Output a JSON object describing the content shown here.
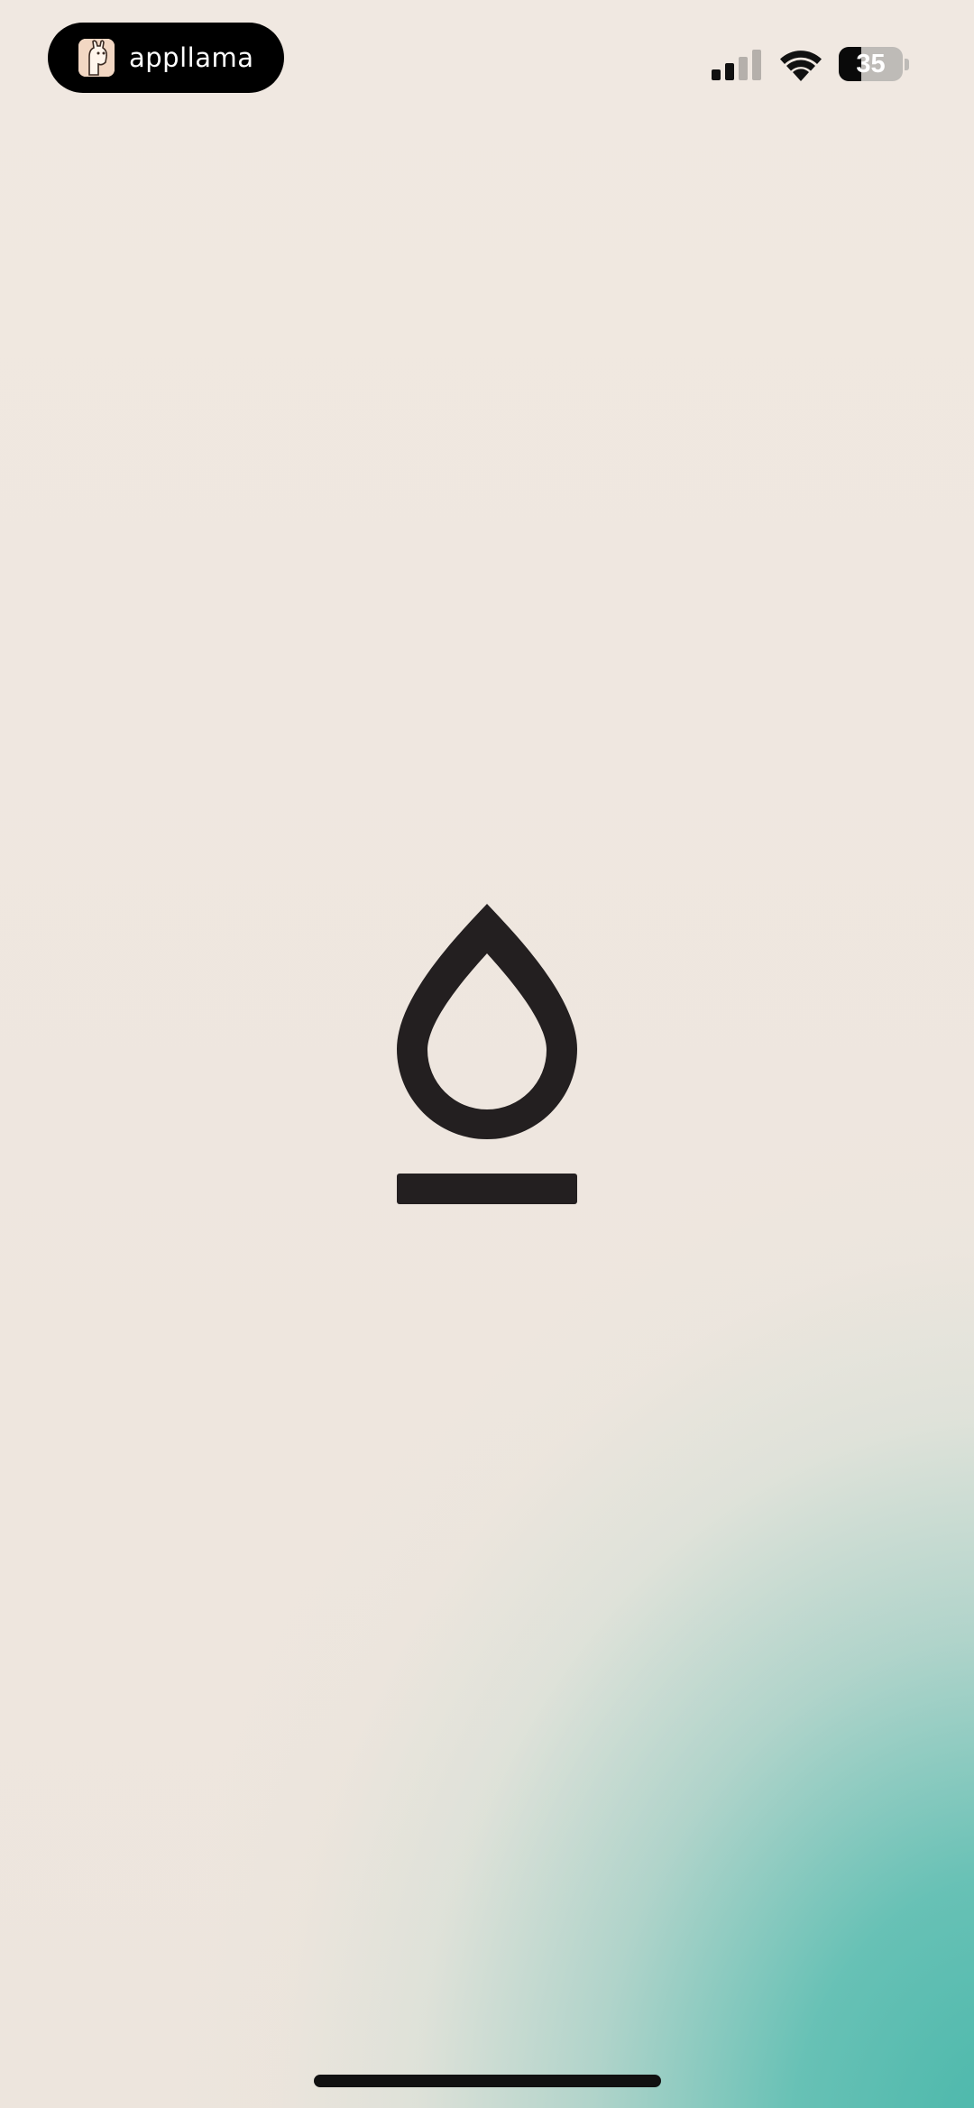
{
  "status_bar": {
    "app_name": "appllama",
    "app_icon": "llama-icon",
    "signal_icon": "cellular-signal-icon",
    "signal_bars_active": 2,
    "signal_bars_total": 4,
    "wifi_icon": "wifi-icon",
    "battery_level": "35",
    "battery_fraction": 0.35
  },
  "logo": {
    "icon": "water-drop-logo-icon"
  },
  "colors": {
    "background": "#efe7df",
    "accent_teal": "#48b7aa",
    "logo_dark": "#231f20"
  }
}
